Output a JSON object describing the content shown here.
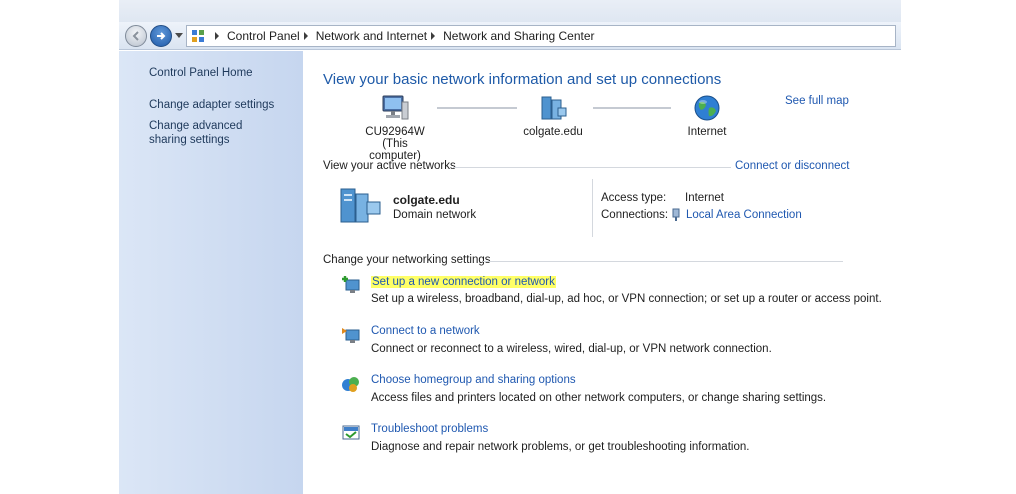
{
  "address": {
    "breadcrumbs": [
      "Control Panel",
      "Network and Internet",
      "Network and Sharing Center"
    ]
  },
  "sidebar": {
    "items": [
      {
        "label": "Control Panel Home"
      },
      {
        "label": "Change adapter settings"
      },
      {
        "label": "Change advanced sharing settings"
      }
    ]
  },
  "main": {
    "heading": "View your basic network information and set up connections",
    "see_full_map": "See full map",
    "map": {
      "computer_name": "CU92964W",
      "computer_sub": "(This computer)",
      "network": "colgate.edu",
      "internet": "Internet"
    },
    "active_networks": {
      "title": "View your active networks",
      "connect_link": "Connect or disconnect",
      "network_name": "colgate.edu",
      "network_type": "Domain network",
      "access_type_label": "Access type:",
      "access_type_value": "Internet",
      "connections_label": "Connections:",
      "connections_value": "Local Area Connection"
    },
    "settings": {
      "title": "Change your networking settings",
      "tasks": [
        {
          "title": "Set up a new connection or network",
          "desc": "Set up a wireless, broadband, dial-up, ad hoc, or VPN connection; or set up a router or access point."
        },
        {
          "title": "Connect to a network",
          "desc": "Connect or reconnect to a wireless, wired, dial-up, or VPN network connection."
        },
        {
          "title": "Choose homegroup and sharing options",
          "desc": "Access files and printers located on other network computers, or change sharing settings."
        },
        {
          "title": "Troubleshoot problems",
          "desc": "Diagnose and repair network problems, or get troubleshooting information."
        }
      ]
    }
  },
  "colors": {
    "link": "#1f58b0",
    "heading": "#1e5aa8",
    "highlight": "#ffff66",
    "sidebar": "#c6d6ef"
  }
}
